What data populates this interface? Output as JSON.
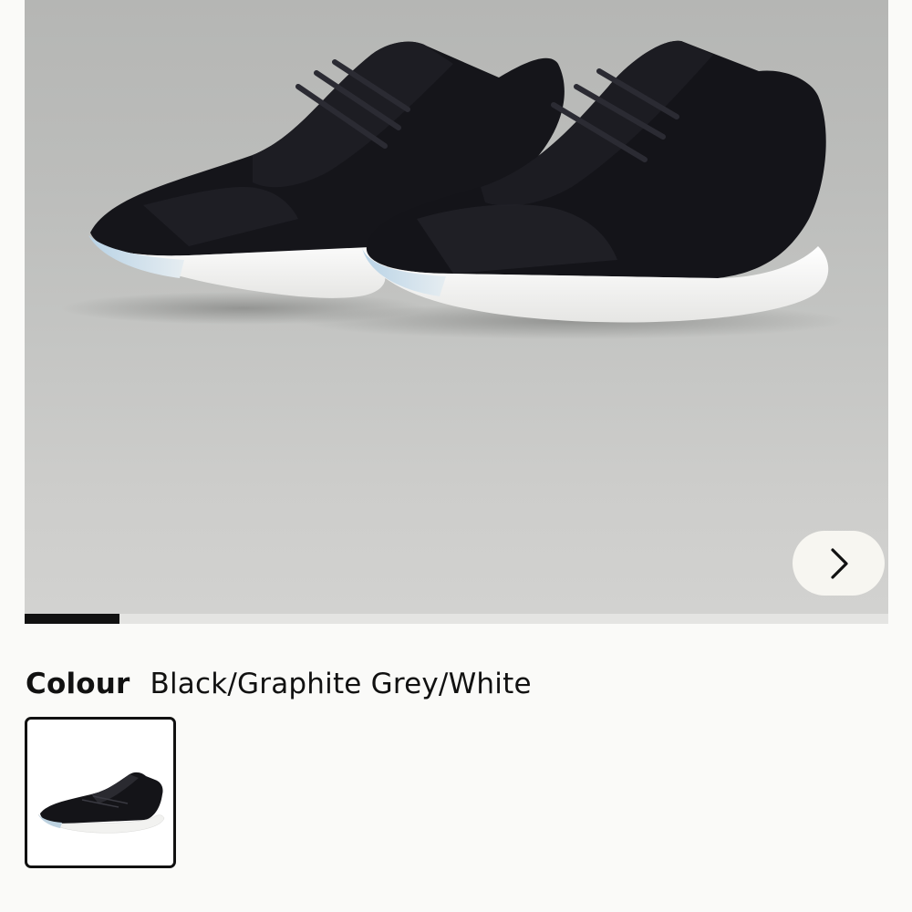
{
  "gallery": {
    "image_alt": "Black sneakers with white soles pictured on a grey background",
    "next_icon": "chevron-right-icon",
    "progress": 0.11
  },
  "colour": {
    "label": "Colour",
    "selected_value": "Black/Graphite Grey/White",
    "swatches": [
      {
        "name": "Black/Graphite Grey/White",
        "selected": true
      }
    ]
  },
  "colors": {
    "background": "#fafaf8",
    "gallery_background": "#c2c3c1",
    "shoe_upper": "#141419",
    "sole": "#f2f2f0",
    "progress_active": "#111111",
    "progress_track": "#e4e4e2",
    "next_button": "#f7f6f1"
  }
}
